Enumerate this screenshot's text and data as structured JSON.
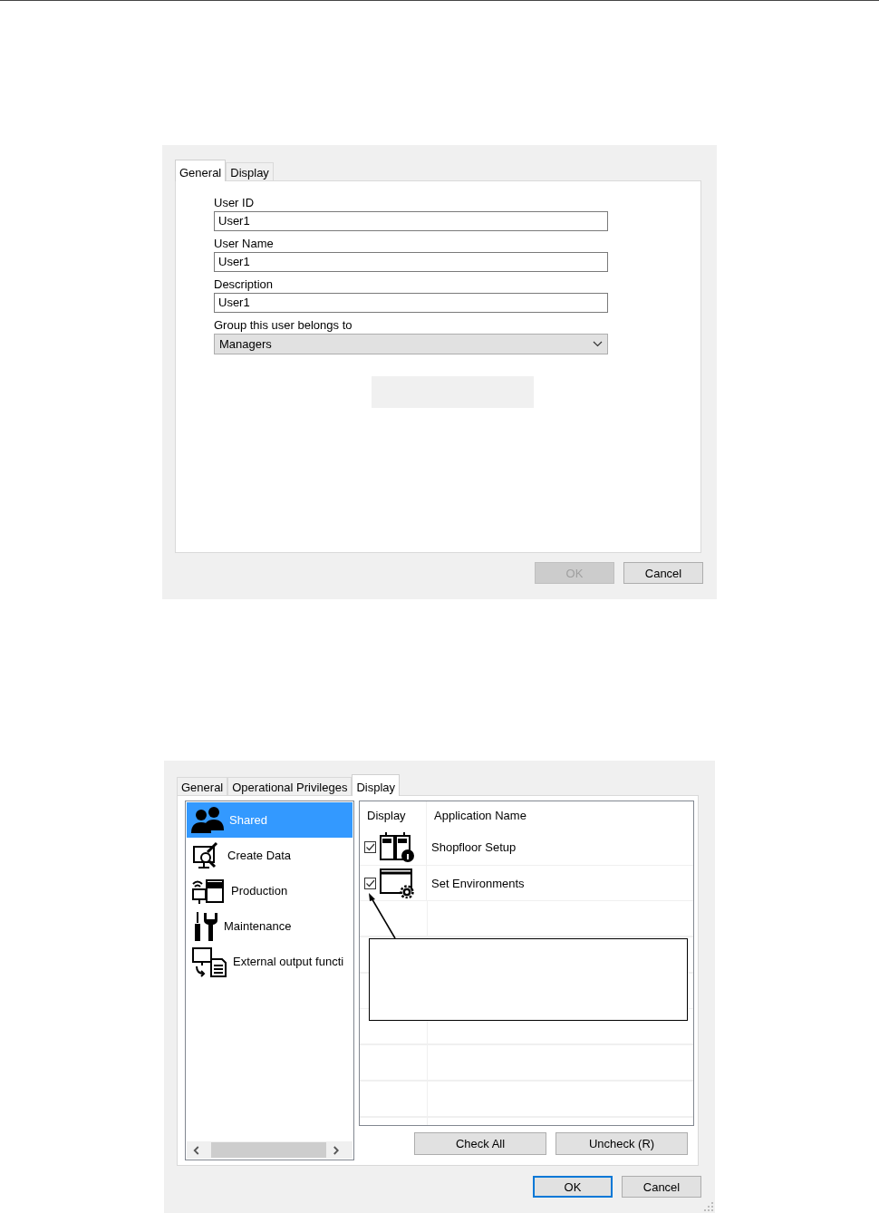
{
  "general_dialog": {
    "tabs": [
      {
        "label": "General",
        "selected": true
      },
      {
        "label": "Display",
        "selected": false
      }
    ],
    "fields": [
      {
        "kind": "text",
        "label": "User ID",
        "value": "User1"
      },
      {
        "kind": "text",
        "label": "User Name",
        "value": "User1"
      },
      {
        "kind": "text",
        "label": "Description",
        "value": "User1"
      },
      {
        "kind": "dropdown",
        "label": "Group this user belongs to",
        "value": "Managers"
      }
    ],
    "buttons": [
      {
        "label": "OK",
        "disabled": true
      },
      {
        "label": "Cancel",
        "disabled": false
      }
    ]
  },
  "display_dialog": {
    "tabs": [
      {
        "label": "General",
        "selected": false
      },
      {
        "label": "Operational Privileges",
        "selected": false
      },
      {
        "label": "Display",
        "selected": true
      }
    ],
    "categories": [
      {
        "label": "Shared",
        "selected": true
      },
      {
        "label": "Create Data",
        "selected": false
      },
      {
        "label": "Production",
        "selected": false
      },
      {
        "label": "Maintenance",
        "selected": false
      },
      {
        "label": "External output functi",
        "selected": false
      }
    ],
    "table": {
      "columns": [
        "Display",
        "Application Name"
      ],
      "rows": [
        {
          "checked": true,
          "name": "Shopfloor Setup"
        },
        {
          "checked": true,
          "name": "Set Environments"
        }
      ]
    },
    "actions": [
      {
        "label": "Check All"
      },
      {
        "label": "Uncheck (R)"
      }
    ],
    "buttons": [
      {
        "label": "OK",
        "default": true
      },
      {
        "label": "Cancel",
        "default": false
      }
    ]
  }
}
